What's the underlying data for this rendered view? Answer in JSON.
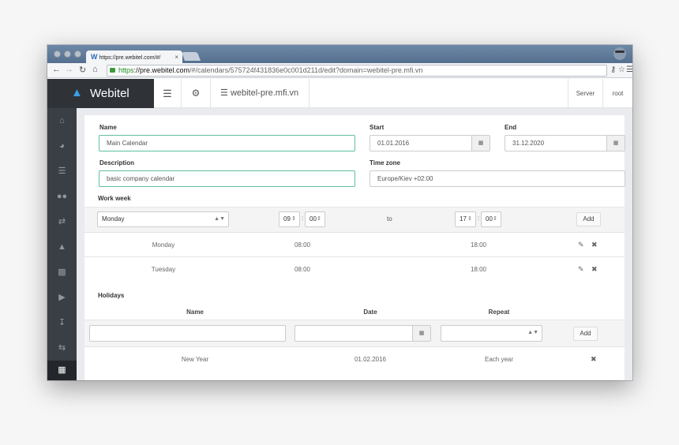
{
  "browser": {
    "tab_title": "https://pre.webitel.com/#/",
    "tab_logo": "W",
    "tab_close": "×",
    "url_scheme": "https",
    "url_host": "://pre.webitel.com",
    "url_path": "/#/calendars/575724f431836e0c001d211d/edit?domain=webitel-pre.mfi.vn",
    "icons": [
      "back-icon",
      "forward-icon",
      "reload-icon",
      "home-icon",
      "lock-icon",
      "key-icon",
      "star-icon",
      "menu-icon"
    ]
  },
  "header": {
    "brand": "Webitel",
    "domain": "webitel-pre.mfi.vn",
    "server_label": "Server",
    "user_label": "root"
  },
  "sidebar": {
    "items": [
      "home-icon",
      "dashboard-icon",
      "database-icon",
      "users-icon",
      "random-icon",
      "sitemap-icon",
      "chart-icon",
      "play-icon",
      "download-icon",
      "exchange-icon",
      "calendar-icon"
    ],
    "active": "calendar-icon"
  },
  "form": {
    "name_label": "Name",
    "name_value": "Main Calendar",
    "start_label": "Start",
    "start_value": "01.01.2016",
    "end_label": "End",
    "end_value": "31.12.2020",
    "description_label": "Description",
    "description_value": "basic company calendar",
    "timezone_label": "Time zone",
    "timezone_value": "Europe/Kiev +02:00"
  },
  "workweek": {
    "label": "Work week",
    "day_select": "Monday",
    "from_hour": "09",
    "from_min": "00",
    "to_label": "to",
    "to_hour": "17",
    "to_min": "00",
    "add_label": "Add",
    "rows": [
      {
        "day": "Monday",
        "start": "08:00",
        "end": "18:00"
      },
      {
        "day": "Tuesday",
        "start": "08:00",
        "end": "18:00"
      }
    ]
  },
  "holidays": {
    "label": "Holidays",
    "col_name": "Name",
    "col_date": "Date",
    "col_repeat": "Repeat",
    "add_label": "Add",
    "rows": [
      {
        "name": "New Year",
        "date": "01.02.2016",
        "repeat": "Each year"
      }
    ]
  }
}
